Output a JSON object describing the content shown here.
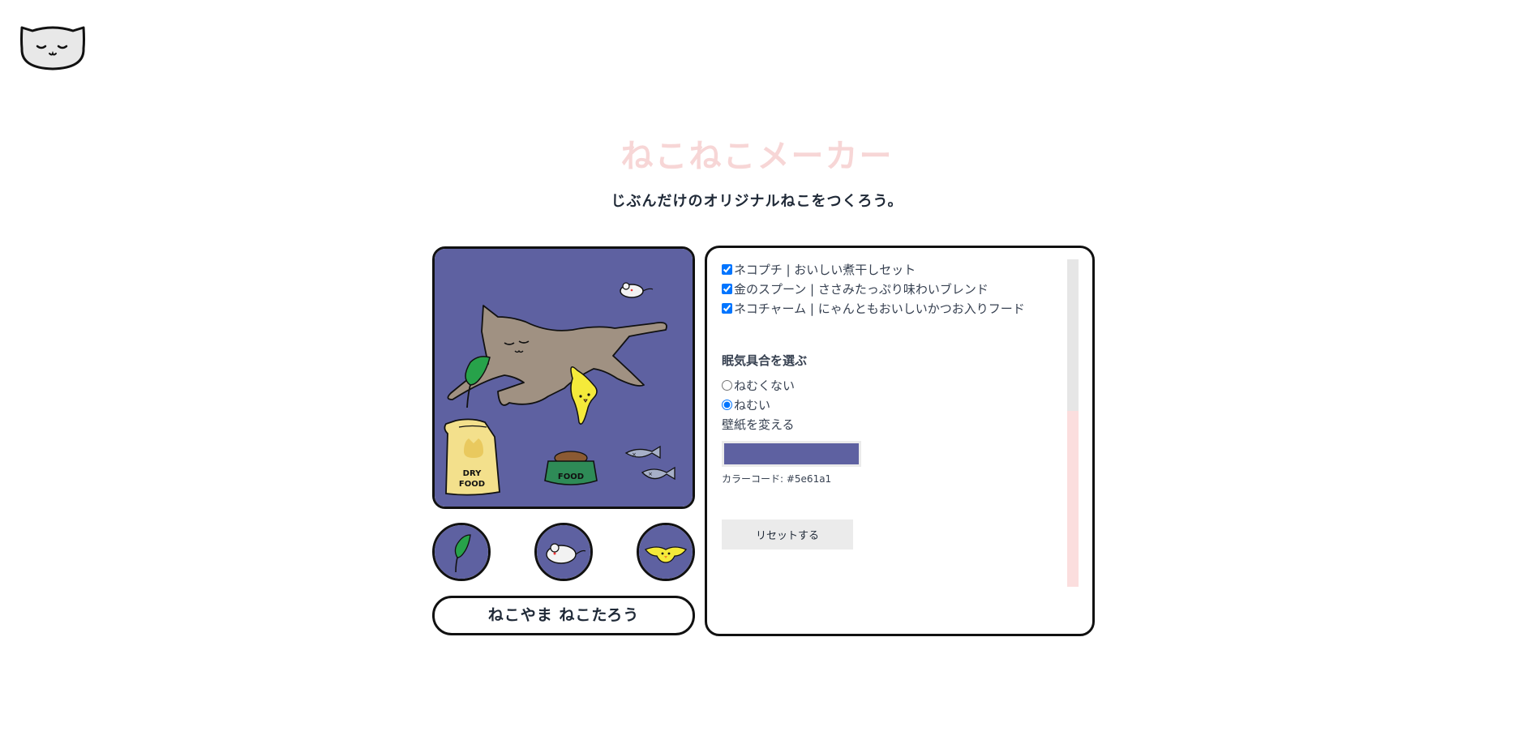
{
  "app": {
    "title": "ねこねこメーカー",
    "subtitle": "じぶんだけのオリジナルねこをつくろう。"
  },
  "cat_name": "ねこやま ねこたろう",
  "wallpaper_color": "#5e61a1",
  "canvas_labels": {
    "dry_food_line1": "DRY",
    "dry_food_line2": "FOOD",
    "bowl": "FOOD"
  },
  "items": [
    {
      "icon": "leaf-icon"
    },
    {
      "icon": "mouse-icon"
    },
    {
      "icon": "bird-icon"
    }
  ],
  "panel": {
    "food_options": [
      {
        "label": "ネコプチ | おいしい煮干しセット",
        "checked": true
      },
      {
        "label": "金のスプーン | ささみたっぷり味わいブレンド",
        "checked": true
      },
      {
        "label": "ネコチャーム | にゃんともおいしいかつお入りフード",
        "checked": true
      }
    ],
    "sleep_title": "眠気具合を選ぶ",
    "sleep_options": [
      {
        "label": "ねむくない",
        "selected": false
      },
      {
        "label": "ねむい",
        "selected": true
      }
    ],
    "wallpaper_label": "壁紙を変える",
    "color_code_label": "カラーコード: #5e61a1",
    "reset_label": "リセットする"
  },
  "colors": {
    "title_pink": "#f7d6d6",
    "cat_body": "#a09182",
    "bird_yellow": "#f5ea3a",
    "leaf_green": "#27a24a",
    "bowl_green": "#2e8b57"
  }
}
